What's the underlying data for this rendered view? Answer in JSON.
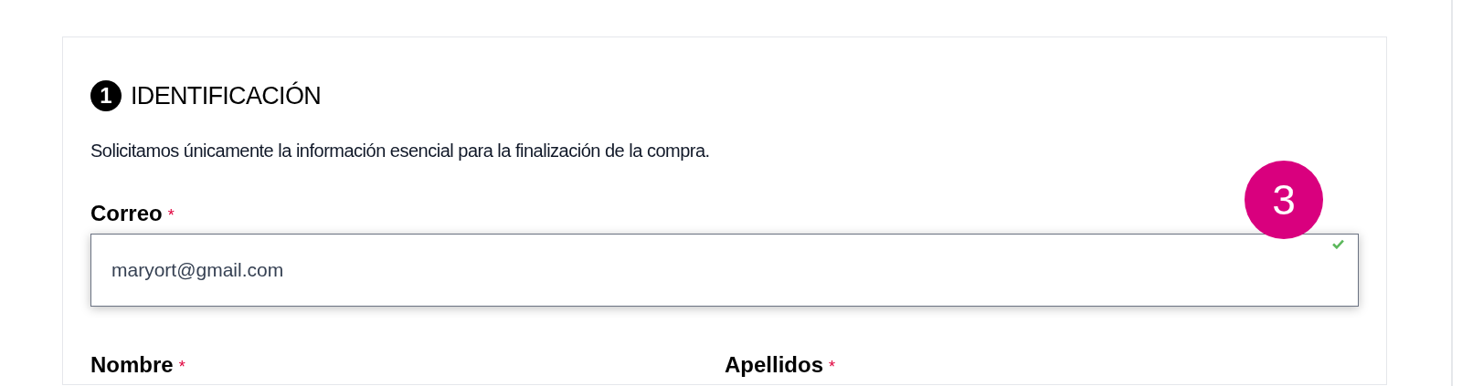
{
  "section": {
    "step": "1",
    "title": "IDENTIFICACIÓN",
    "description": "Solicitamos únicamente la información esencial para la finalización de la compra."
  },
  "fields": [
    {
      "label": "Correo",
      "required_mark": "*",
      "value": "maryort@gmail.com",
      "valid": true
    }
  ],
  "callout": {
    "number": "3"
  },
  "next_fields": [
    {
      "label": "Nombre",
      "required_mark": "*"
    },
    {
      "label": "Apellidos",
      "required_mark": "*"
    }
  ]
}
